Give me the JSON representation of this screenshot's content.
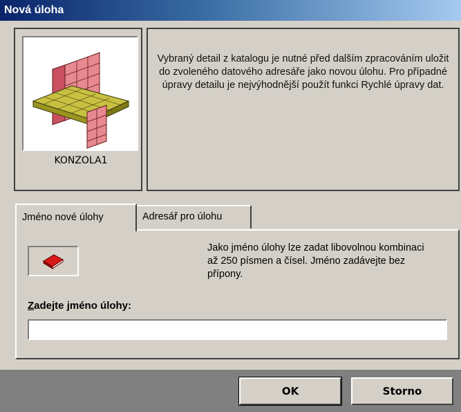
{
  "window": {
    "title": "Nová úloha"
  },
  "detail": {
    "name": "KONZOLA1",
    "image_icon": "console-detail-3d-icon",
    "description": "Vybraný detail z katalogu je nutné před dalším zpracováním uložit do zvoleného datového adresáře jako novou úlohu. Pro případné úpravy detailu je nejvýhodnější použít funkci Rychlé úpravy dat."
  },
  "tabs": [
    {
      "label": "Jméno nové úlohy",
      "active": true
    },
    {
      "label": "Adresář pro úlohu",
      "active": false
    }
  ],
  "name_tab": {
    "icon": "red-book-icon",
    "hint": "Jako jméno úlohy lze zadat libovolnou kombinaci až 250 písmen a čísel. Jméno zadávejte bez přípony.",
    "prompt_prefix": "Z",
    "prompt_rest": "adejte jméno úlohy:",
    "input_value": ""
  },
  "buttons": {
    "ok": "OK",
    "cancel": "Storno"
  },
  "colors": {
    "dialog_bg": "#d4d0c8",
    "titlebar_start": "#0a246a",
    "titlebar_end": "#a6caf0",
    "book_red": "#d81818"
  }
}
